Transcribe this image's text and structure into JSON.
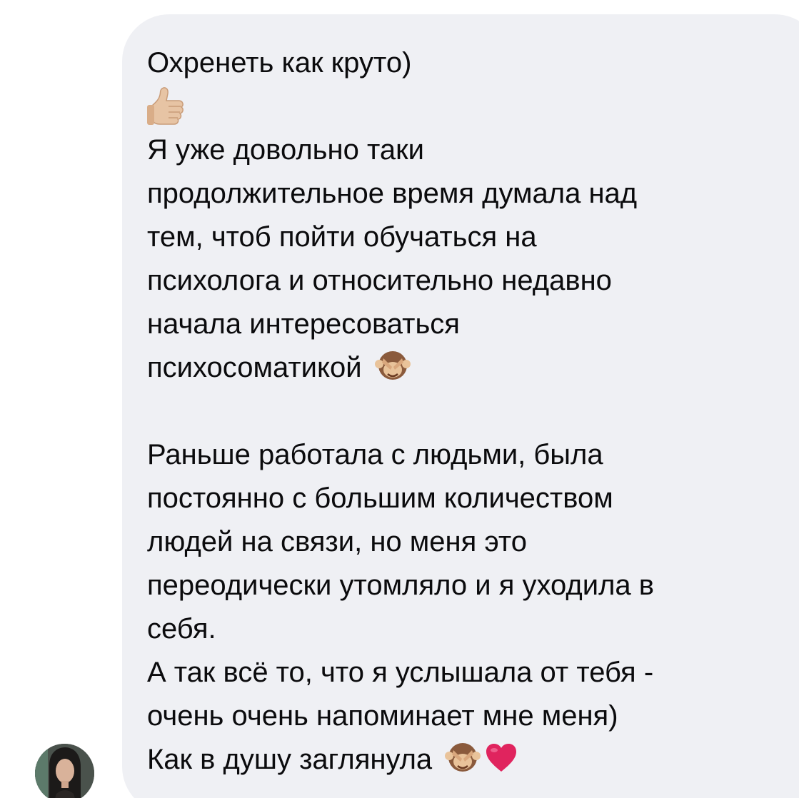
{
  "message": {
    "lines": [
      "Охренеть как круто)",
      "",
      "Я уже довольно таки",
      "продолжительное время думала над",
      "тем, чтоб пойти обучаться на",
      "психолога и относительно недавно",
      "начала интересоваться",
      "психосоматикой",
      "",
      "Раньше работала с людьми, была",
      "постоянно с большим количеством",
      "людей на связи, но меня это",
      "переодически утомляло и я уходила в",
      "себя.",
      "А так всё то, что я услышала от тебя -",
      "очень очень напоминает мне меня)",
      "Как в душу заглянула"
    ],
    "emojis": {
      "line2": "thumbs-up-icon",
      "line8": "see-no-evil-monkey-icon",
      "line17": [
        "see-no-evil-monkey-icon",
        "red-heart-icon"
      ]
    }
  },
  "colors": {
    "bubble_bg": "#eff0f4",
    "text": "#0b0b0d",
    "heart": "#e0245e"
  }
}
